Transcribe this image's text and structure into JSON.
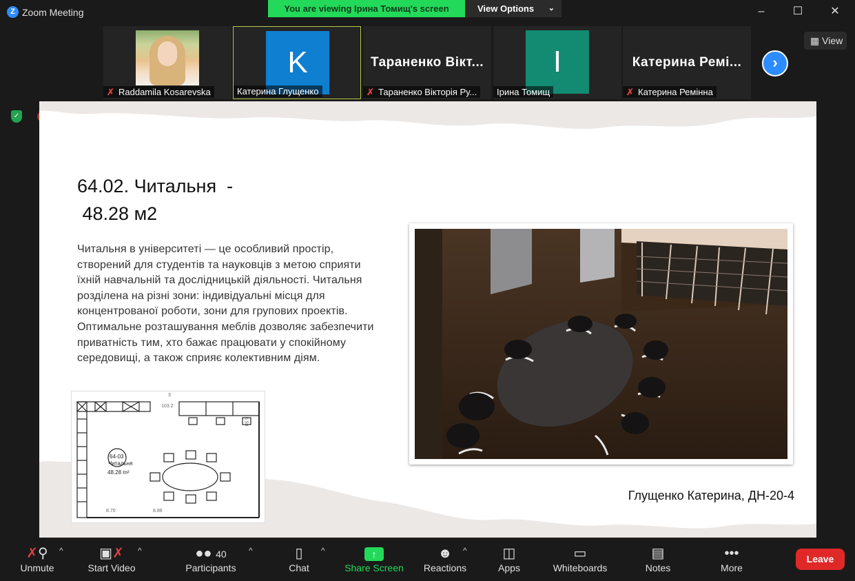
{
  "window": {
    "title": "Zoom Meeting",
    "logo_letter": "Z"
  },
  "banner": {
    "text": "You are viewing Ірина Томищ's screen",
    "view_options": "View Options"
  },
  "view_button": "View",
  "participants": [
    {
      "name": "Raddamila Kosarevska",
      "muted": true,
      "kind": "photo"
    },
    {
      "name": "Катерина Глущенко",
      "muted": false,
      "kind": "avatar",
      "initial": "K",
      "color": "#0e7fd1"
    },
    {
      "name": "Тараненко Вікторія Ру...",
      "muted": true,
      "kind": "text",
      "display": "Тараненко Вікт..."
    },
    {
      "name": "Ірина Томищ",
      "muted": false,
      "kind": "avatar",
      "initial": "I",
      "color": "#138a72"
    },
    {
      "name": "Катерина Ремінна",
      "muted": true,
      "kind": "text",
      "display": "Катерина Ремі..."
    }
  ],
  "slide": {
    "title_line1": "64.02. Читальня  -",
    "title_line2": " 48.28 м2",
    "body": "Читальня в університеті — це особливий простір, створений для студентів та науковців з метою сприяти їхній навчальній та дослідницькій діяльності. Читальня розділена на різні зони: індивідуальні місця для концентрованої роботи, зони для групових проектів. Оптимальне розташування меблів дозволяє забезпечити приватність тим, хто бажає працювати у спокійному середовищі, а також сприяє колективним діям.",
    "author": "Глущенко Катерина, ДН-20-4",
    "plan": {
      "room_code": "64-03",
      "room_name": "Читальня",
      "room_area": "48.28 m²",
      "dim_top": "103.2",
      "dim_3": "3",
      "dim_left": "8.70",
      "dim_mid": "8.86",
      "dim_right": "0.59"
    }
  },
  "toolbar": {
    "unmute": "Unmute",
    "start_video": "Start Video",
    "participants": "Participants",
    "participants_count": "40",
    "chat": "Chat",
    "share_screen": "Share Screen",
    "reactions": "Reactions",
    "apps": "Apps",
    "whiteboards": "Whiteboards",
    "notes": "Notes",
    "more": "More",
    "leave": "Leave"
  },
  "colors": {
    "share_green": "#23d959",
    "leave_red": "#e02828",
    "zoom_blue": "#2d8cff"
  }
}
